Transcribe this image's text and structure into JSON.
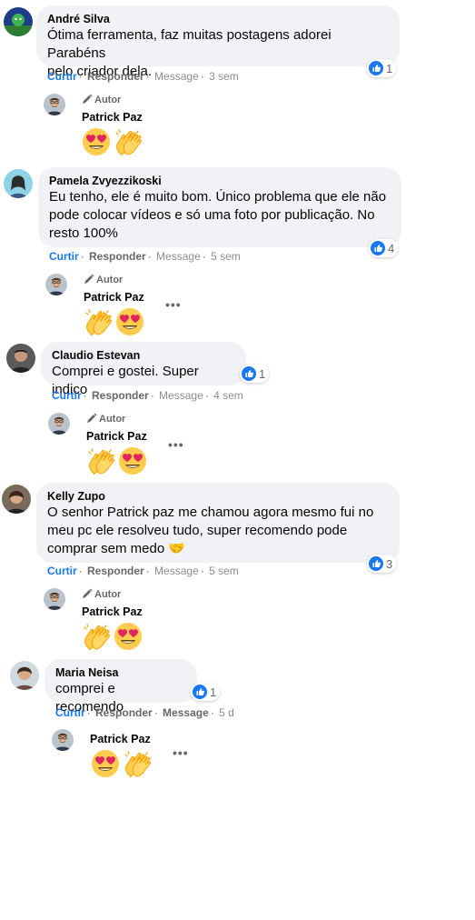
{
  "actions": {
    "like": "Curtir",
    "reply": "Responder",
    "message": "Message",
    "sep": "·"
  },
  "author_label": "Autor",
  "comments": [
    {
      "name": "André Silva",
      "text": [
        "Ótima ferramenta, faz muitas postagens adorei Parabéns",
        "pelo criador dela."
      ],
      "time": "3 sem",
      "likes": "1",
      "reply": {
        "name": "Patrick Paz",
        "emojis": [
          "heart-eyes-emoji",
          "clapping-hands-emoji"
        ]
      }
    },
    {
      "name": "Pamela Zvyezzikoski",
      "text": [
        "Eu tenho, ele é muito bom. Único problema que ele não",
        "pode colocar vídeos e só uma foto por publicação. No",
        "resto 100%"
      ],
      "time": "5 sem",
      "likes": "4",
      "reply": {
        "name": "Patrick Paz",
        "emojis": [
          "clapping-hands-emoji",
          "heart-eyes-emoji"
        ]
      }
    },
    {
      "name": "Claudio Estevan",
      "text": [
        "Comprei e gostei. Super indico"
      ],
      "time": "4 sem",
      "likes": "1",
      "reply": {
        "name": "Patrick Paz",
        "emojis": [
          "clapping-hands-emoji",
          "heart-eyes-emoji"
        ]
      }
    },
    {
      "name": "Kelly Zupo",
      "text": [
        "O senhor Patrick paz me chamou agora mesmo fui no",
        "meu pc ele resolveu tudo, super recomendo pode",
        "comprar sem medo 🤝"
      ],
      "time": "5 sem",
      "likes": "3",
      "reply": {
        "name": "Patrick Paz",
        "emojis": [
          "clapping-hands-emoji",
          "heart-eyes-emoji"
        ]
      }
    },
    {
      "name": "Maria Neisa",
      "text": [
        "comprei e recomendo"
      ],
      "time": "5 d",
      "likes": "1",
      "reply": {
        "name": "Patrick Paz",
        "emojis": [
          "heart-eyes-emoji",
          "clapping-hands-emoji"
        ]
      }
    }
  ],
  "colors": {
    "bubble": "#f0f2f5",
    "like_blue": "#1877f2",
    "meta_grey": "#65676b"
  }
}
